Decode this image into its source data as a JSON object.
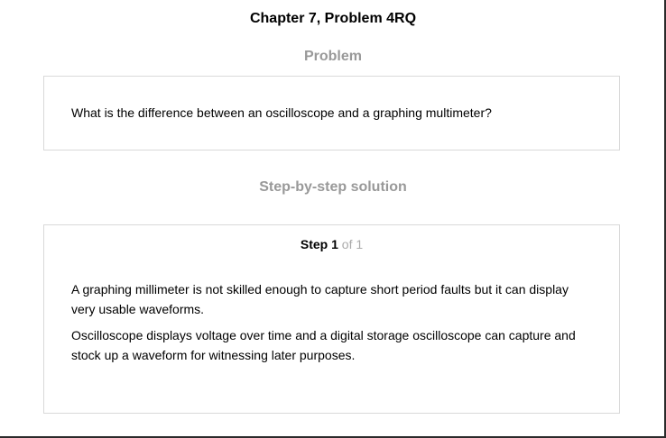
{
  "header": {
    "title": "Chapter 7, Problem 4RQ"
  },
  "problem": {
    "heading": "Problem",
    "text": "What is the difference between an oscilloscope and a graphing multimeter?"
  },
  "solution": {
    "heading": "Step-by-step solution",
    "step": {
      "word": "Step",
      "number": "1",
      "of_text": "of 1",
      "paragraphs": [
        "A graphing millimeter is not skilled enough to capture short period faults but it can display very usable waveforms.",
        "Oscilloscope displays voltage over time and a digital storage oscilloscope can capture and stock up a waveform for witnessing later purposes."
      ]
    }
  },
  "colors": {
    "heading_gray": "#999999",
    "card_border": "#d9d9d9",
    "step_of_gray": "#aaaaaa",
    "text": "#000000"
  }
}
